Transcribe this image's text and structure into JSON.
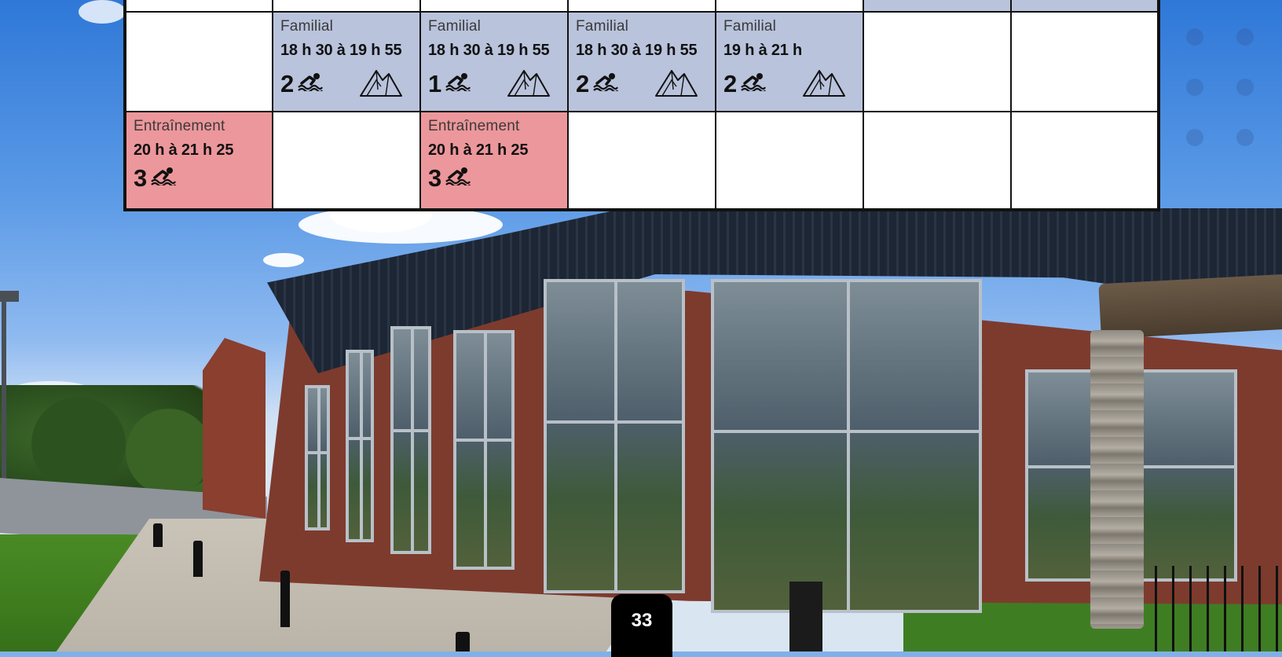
{
  "schedule": {
    "row1": [
      {
        "empty": true
      },
      {
        "activity": "Familial",
        "time": "18 h 30 à 19 h 55",
        "lanes": "2",
        "color": "#b9c3dc"
      },
      {
        "activity": "Familial",
        "time": "18 h 30 à 19 h 55",
        "lanes": "1",
        "color": "#b9c3dc"
      },
      {
        "activity": "Familial",
        "time": "18 h 30 à 19 h 55",
        "lanes": "2",
        "color": "#b9c3dc"
      },
      {
        "activity": "Familial",
        "time": "19 h à 21 h",
        "lanes": "2",
        "color": "#b9c3dc"
      },
      {
        "empty": true
      },
      {
        "empty": true
      }
    ],
    "row2": [
      {
        "activity": "Entraînement",
        "time": "20 h à 21 h 25",
        "lanes": "3",
        "color": "#ec979b"
      },
      {
        "empty": true
      },
      {
        "activity": "Entraînement",
        "time": "20 h à 21 h 25",
        "lanes": "3",
        "color": "#ec979b"
      },
      {
        "empty": true
      },
      {
        "empty": true
      },
      {
        "empty": true
      },
      {
        "empty": true
      }
    ],
    "icons": {
      "swim": "swimmer-icon",
      "mountain": "mountain-icon"
    }
  },
  "page_number": "33"
}
